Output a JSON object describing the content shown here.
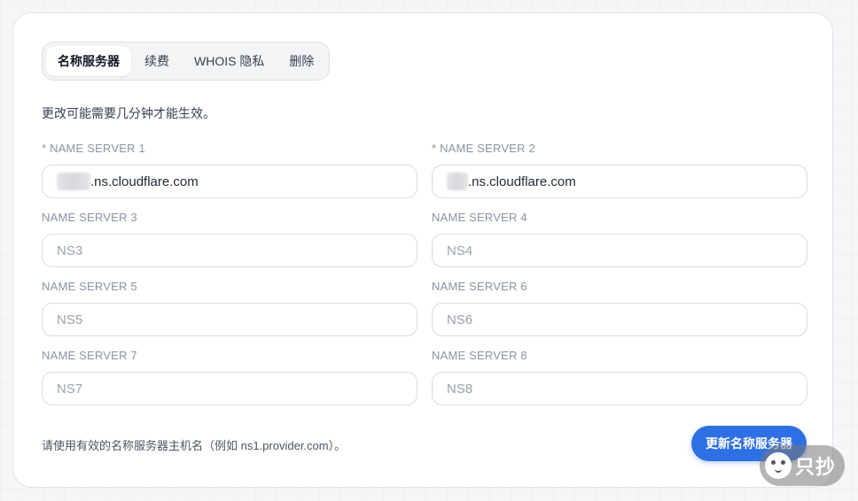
{
  "tabs": [
    {
      "label": "名称服务器",
      "active": true
    },
    {
      "label": "续费",
      "active": false
    },
    {
      "label": "WHOIS 隐私",
      "active": false
    },
    {
      "label": "删除",
      "active": false
    }
  ],
  "description": "更改可能需要几分钟才能生效。",
  "fields": {
    "ns1": {
      "label": "* NAME SERVER 1",
      "value": ".ns.cloudflare.com",
      "placeholder": ""
    },
    "ns2": {
      "label": "* NAME SERVER 2",
      "value": ".ns.cloudflare.com",
      "placeholder": ""
    },
    "ns3": {
      "label": "NAME SERVER 3",
      "value": "",
      "placeholder": "NS3"
    },
    "ns4": {
      "label": "NAME SERVER 4",
      "value": "",
      "placeholder": "NS4"
    },
    "ns5": {
      "label": "NAME SERVER 5",
      "value": "",
      "placeholder": "NS5"
    },
    "ns6": {
      "label": "NAME SERVER 6",
      "value": "",
      "placeholder": "NS6"
    },
    "ns7": {
      "label": "NAME SERVER 7",
      "value": "",
      "placeholder": "NS7"
    },
    "ns8": {
      "label": "NAME SERVER 8",
      "value": "",
      "placeholder": "NS8"
    }
  },
  "hint": "请使用有效的名称服务器主机名（例如 ns1.provider.com）。",
  "submit_label": "更新名称服务器",
  "watermark": {
    "text": "只抄",
    "icon": "cat-face-icon"
  },
  "colors": {
    "accent": "#2f6fe4",
    "label": "#8a94a3",
    "border": "#d7dbe1"
  }
}
